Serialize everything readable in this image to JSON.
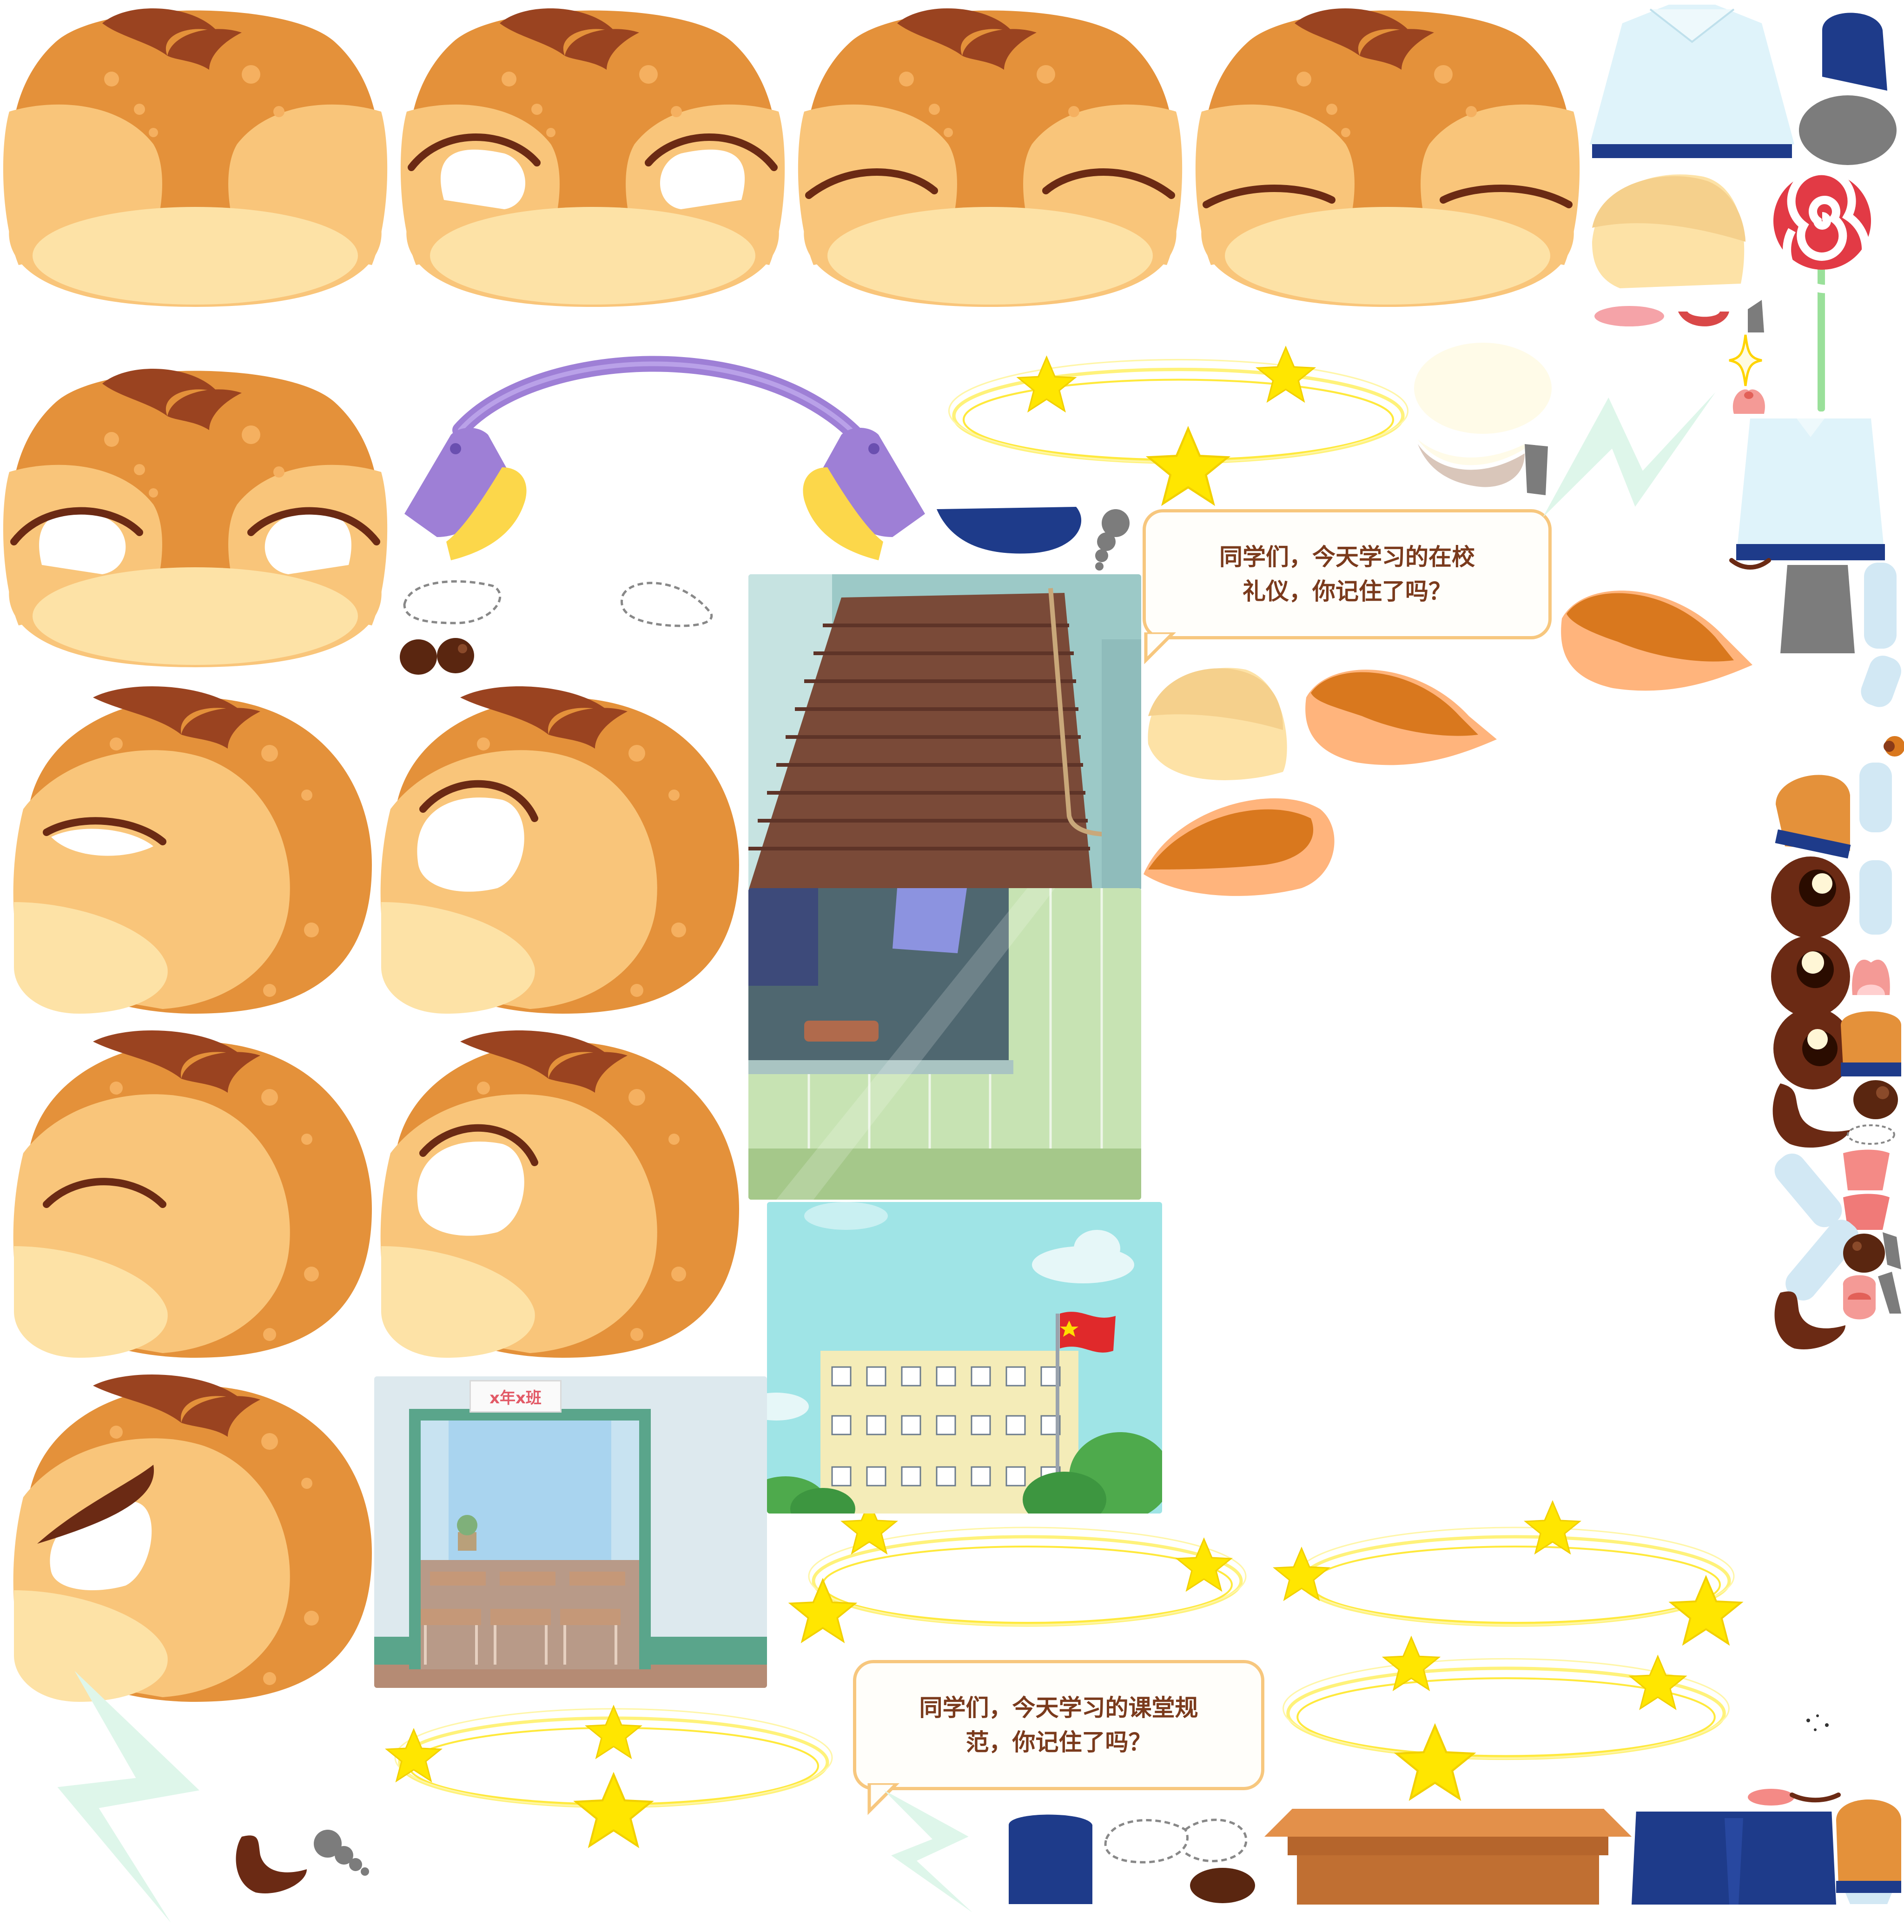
{
  "sheet": {
    "bubbles": [
      {
        "text": "同学们，今天学习的在校\n礼仪，你记住了吗？"
      },
      {
        "text": "同学们，今天学习的课堂规\n范，你记住了吗？"
      }
    ],
    "scenes": {
      "classroom_sign": "x年x班"
    }
  },
  "colors": {
    "head_orange": "#e4913a",
    "face_light": "#f9c57a",
    "muzzle": "#fde2a6",
    "hair_brown": "#9a4320",
    "eye_line": "#6b2a14",
    "star_yellow": "#ffe600",
    "bubble_border": "#f7c77e",
    "bubble_text": "#7a3a1c",
    "headphone_purple": "#9e7fd6",
    "headphone_yellow": "#fcd74a",
    "navy": "#1e3b8a"
  },
  "icons": [
    "beaver-head-front",
    "beaver-head-side",
    "headphones",
    "star-ring",
    "lollipop",
    "lightning",
    "desk",
    "school-building",
    "classroom-door",
    "staircase",
    "chalkboard"
  ]
}
